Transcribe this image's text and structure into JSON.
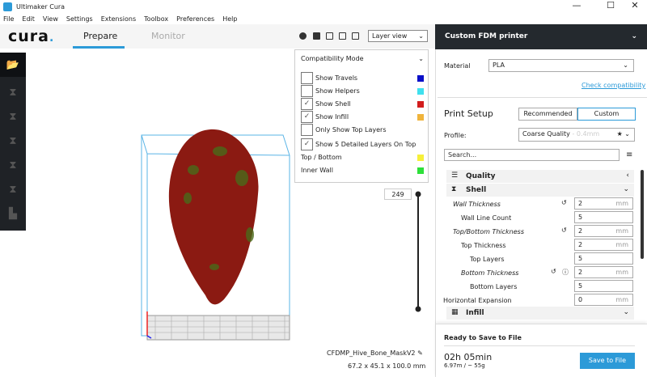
{
  "window": {
    "title": "Ultimaker Cura",
    "minimize": "—",
    "maximize": "☐",
    "close": "✕"
  },
  "menu": [
    "File",
    "Edit",
    "View",
    "Settings",
    "Extensions",
    "Toolbox",
    "Preferences",
    "Help"
  ],
  "header": {
    "brand": "cura",
    "brand_dot": ".",
    "tabs": [
      {
        "label": "Prepare",
        "active": true
      },
      {
        "label": "Monitor",
        "active": false
      }
    ],
    "view_select": "Layer view"
  },
  "layer_popup": {
    "mode": "Compatibility Mode",
    "options": [
      {
        "label": "Show Travels",
        "checked": false,
        "color": "#0a0fc8"
      },
      {
        "label": "Show Helpers",
        "checked": false,
        "color": "#3fe0ee"
      },
      {
        "label": "Show Shell",
        "checked": true,
        "color": "#d21d1d"
      },
      {
        "label": "Show Infill",
        "checked": true,
        "color": "#f0b43c"
      },
      {
        "label": "Only Show Top Layers",
        "checked": false
      },
      {
        "label": "Show 5 Detailed Layers On Top",
        "checked": true
      }
    ],
    "legend": [
      {
        "label": "Top / Bottom",
        "color": "#f6f03a"
      },
      {
        "label": "Inner Wall",
        "color": "#2ee03a"
      }
    ]
  },
  "layer_slider": {
    "value": "249"
  },
  "model": {
    "name": "CFDMP_Hive_Bone_MaskV2",
    "dimensions": "67.2 x 45.1 x 100.0 mm"
  },
  "printer": {
    "name": "Custom FDM printer"
  },
  "material": {
    "label": "Material",
    "value": "PLA",
    "link": "Check compatibility"
  },
  "print_setup": {
    "title": "Print Setup",
    "modes": [
      "Recommended",
      "Custom"
    ],
    "active_mode": "Custom",
    "profile_label": "Profile:",
    "profile": "Coarse Quality",
    "profile_sub": "- 0.4mm",
    "search_placeholder": "Search..."
  },
  "categories": {
    "quality": "Quality",
    "shell": "Shell",
    "infill": "Infill"
  },
  "settings": [
    {
      "label": "Wall Thickness",
      "value": "2",
      "unit": "mm",
      "italic": true,
      "reset": true
    },
    {
      "label": "Wall Line Count",
      "value": "5",
      "unit": ""
    },
    {
      "label": "Top/Bottom Thickness",
      "value": "2",
      "unit": "mm",
      "italic": true,
      "reset": true
    },
    {
      "label": "Top Thickness",
      "value": "2",
      "unit": "mm"
    },
    {
      "label": "Top Layers",
      "value": "5",
      "unit": ""
    },
    {
      "label": "Bottom Thickness",
      "value": "2",
      "unit": "mm",
      "italic": true,
      "reset": true,
      "info": true
    },
    {
      "label": "Bottom Layers",
      "value": "5",
      "unit": ""
    },
    {
      "label": "Horizontal Expansion",
      "value": "0",
      "unit": "mm"
    }
  ],
  "output": {
    "status": "Ready to Save to File",
    "time": "02h 05min",
    "material_use": "6.97m / ~ 55g",
    "save_button": "Save to File"
  },
  "colors": {
    "accent": "#2c9ad8",
    "dark": "#24292e",
    "model": "#8b1a12"
  }
}
